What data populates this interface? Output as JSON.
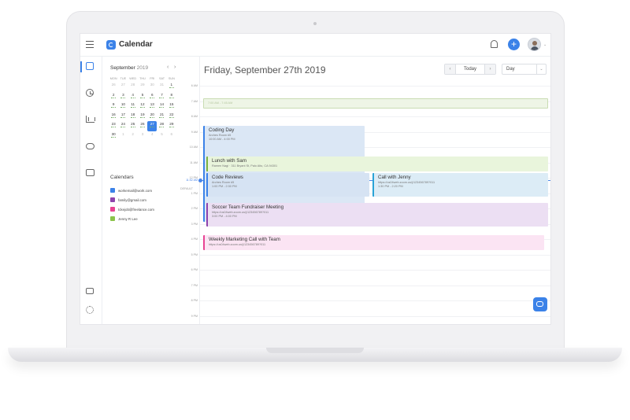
{
  "app": {
    "title": "Calendar"
  },
  "header": {
    "add_label": "+",
    "avatar_caret": "⌄"
  },
  "mini_calendar": {
    "month": "September",
    "year": "2019",
    "prev": "‹",
    "next": "›",
    "weekdays": [
      "MON",
      "TUE",
      "WED",
      "THU",
      "FRI",
      "SAT",
      "SUN"
    ],
    "weeks": [
      [
        {
          "d": "26",
          "m": true
        },
        {
          "d": "27",
          "m": true
        },
        {
          "d": "28",
          "m": true
        },
        {
          "d": "29",
          "m": true
        },
        {
          "d": "30",
          "m": true
        },
        {
          "d": "31",
          "m": true
        },
        {
          "d": "1"
        }
      ],
      [
        {
          "d": "2"
        },
        {
          "d": "3"
        },
        {
          "d": "4"
        },
        {
          "d": "5"
        },
        {
          "d": "6"
        },
        {
          "d": "7"
        },
        {
          "d": "8"
        }
      ],
      [
        {
          "d": "9"
        },
        {
          "d": "10"
        },
        {
          "d": "11"
        },
        {
          "d": "12"
        },
        {
          "d": "13"
        },
        {
          "d": "14"
        },
        {
          "d": "15"
        }
      ],
      [
        {
          "d": "16"
        },
        {
          "d": "17"
        },
        {
          "d": "18"
        },
        {
          "d": "19"
        },
        {
          "d": "20"
        },
        {
          "d": "21"
        },
        {
          "d": "22"
        }
      ],
      [
        {
          "d": "23"
        },
        {
          "d": "24"
        },
        {
          "d": "25"
        },
        {
          "d": "26"
        },
        {
          "d": "27",
          "sel": true
        },
        {
          "d": "28"
        },
        {
          "d": "29"
        }
      ],
      [
        {
          "d": "30"
        },
        {
          "d": "1",
          "m": true
        },
        {
          "d": "2",
          "m": true
        },
        {
          "d": "3",
          "m": true
        },
        {
          "d": "4",
          "m": true
        },
        {
          "d": "5",
          "m": true
        },
        {
          "d": "6",
          "m": true
        }
      ]
    ]
  },
  "calendars": {
    "heading": "Calendars",
    "default_label": "DEFAULT",
    "items": [
      {
        "label": "workemail@work.com",
        "color": "#3b82e8"
      },
      {
        "label": "family@gmail.com",
        "color": "#8e44ad"
      },
      {
        "label": "tckejob@freelance.com",
        "color": "#e84393"
      },
      {
        "label": "Jenny R Lee",
        "color": "#8bc34a"
      }
    ]
  },
  "main": {
    "date_title": "Friday, September 27th 2019",
    "prev": "‹",
    "today": "Today",
    "next": "›",
    "view": "Day",
    "view_arrow": "⌄",
    "hour_labels": [
      "6 AM",
      "7 AM",
      "8 AM",
      "9 AM",
      "10 AM",
      "11 AM",
      "12 PM",
      "1 PM",
      "2 PM",
      "3 PM",
      "4 PM",
      "5 PM",
      "6 PM",
      "7 PM",
      "8 PM",
      "9 PM",
      "10 PM"
    ],
    "now_label": "11:52 AM"
  },
  "events": [
    {
      "title": "",
      "sub1": "7:00 AM - 7:45 AM",
      "sub2": "",
      "color": "#eef5e6",
      "border": "#c9dcb3",
      "faint": true
    },
    {
      "title": "Coding Day",
      "sub1": "Arches Room #5",
      "sub2": "10:00 AM - 4:00 PM",
      "color": "#dbe7f5",
      "border": "#3b82e8"
    },
    {
      "title": "Lunch with Sam",
      "sub1": "Ramen Nagi · 311 Bryant St, Palo Alto, CA 94301",
      "sub2": "",
      "color": "#e9f5dc",
      "border": "#7cb342"
    },
    {
      "title": "Code Reviews",
      "sub1": "Arches Room #5",
      "sub2": "1:00 PM - 2:30 PM",
      "color": "#d6e3f3",
      "border": "#3b82e8"
    },
    {
      "title": "Call with Jenny",
      "sub1": "https://us04web.zoom.us/j/123456789?011",
      "sub2": "1:30 PM - 2:20 PM",
      "color": "#dcecf6",
      "border": "#29a3d6"
    },
    {
      "title": "Soccer Team Fundraiser Meeting",
      "sub1": "https://us04web.zoom.us/j/123456789?011",
      "sub2": "3:00 PM - 4:00 PM",
      "color": "#ecdff3",
      "border": "#8e44ad"
    },
    {
      "title": "Weekly Marketing Call with Team",
      "sub1": "https://us04web.zoom.us/j/123456789?011",
      "sub2": "",
      "color": "#fbe4f3",
      "border": "#e84393"
    }
  ]
}
